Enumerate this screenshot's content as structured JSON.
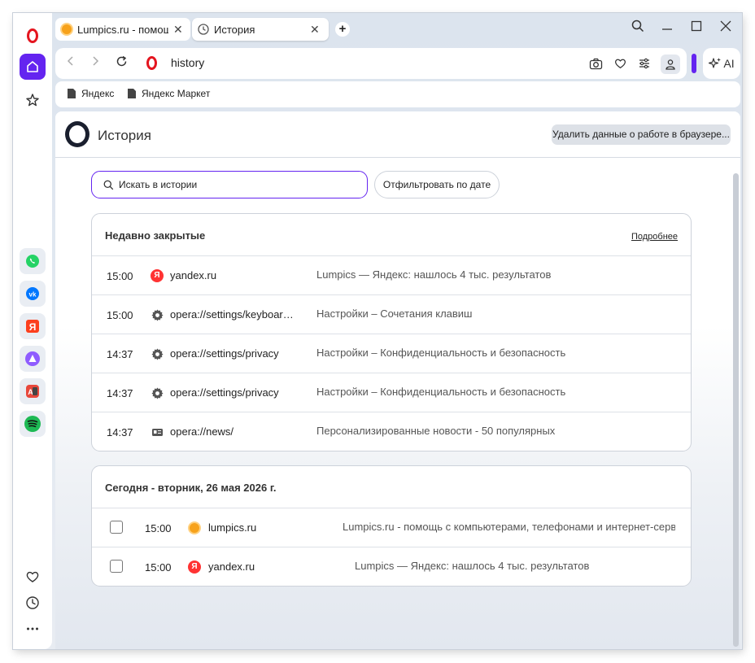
{
  "tabs": [
    {
      "label": "Lumpics.ru - помощь с компьютерами",
      "close": "✕"
    },
    {
      "label": "История",
      "close": "✕"
    }
  ],
  "new_tab": "+",
  "address": {
    "url": "history"
  },
  "ai_label": "AI",
  "bookmarks": [
    {
      "label": "Яндекс"
    },
    {
      "label": "Яндекс Маркет"
    }
  ],
  "page": {
    "title": "История",
    "clear_button": "Удалить данные о работе в браузере...",
    "search_placeholder": "Искать в истории",
    "filter_button": "Отфильтровать по дате"
  },
  "recently_closed": {
    "title": "Недавно закрытые",
    "more_link": "Подробнее",
    "rows": [
      {
        "time": "15:00",
        "icon": "yandex-icon",
        "site": "yandex.ru",
        "desc": "Lumpics — Яндекс: нашлось 4 тыс. результатов"
      },
      {
        "time": "15:00",
        "icon": "gear-icon",
        "site": "opera://settings/keyboardShortcuts",
        "desc": "Настройки – Сочетания клавиш"
      },
      {
        "time": "14:37",
        "icon": "gear-icon",
        "site": "opera://settings/privacy",
        "desc": "Настройки – Конфиденциальность и безопасность"
      },
      {
        "time": "14:37",
        "icon": "gear-icon",
        "site": "opera://settings/privacy",
        "desc": "Настройки – Конфиденциальность и безопасность"
      },
      {
        "time": "14:37",
        "icon": "news-icon",
        "site": "opera://news/",
        "desc": "Персонализированные новости - 50 популярных"
      }
    ]
  },
  "today": {
    "title": "Сегодня - вторник, 26 мая 2026 г.",
    "rows": [
      {
        "time": "15:00",
        "icon": "lumpics-icon",
        "site": "lumpics.ru",
        "desc": "Lumpics.ru - помощь с компьютерами, телефонами и интернет-сервисами"
      },
      {
        "time": "15:00",
        "icon": "yandex-icon",
        "site": "yandex.ru",
        "desc": "Lumpics — Яндекс: нашлось 4 тыс. результатов"
      }
    ]
  },
  "colors": {
    "accent": "#6424f0",
    "opera_red": "#e4151f"
  }
}
